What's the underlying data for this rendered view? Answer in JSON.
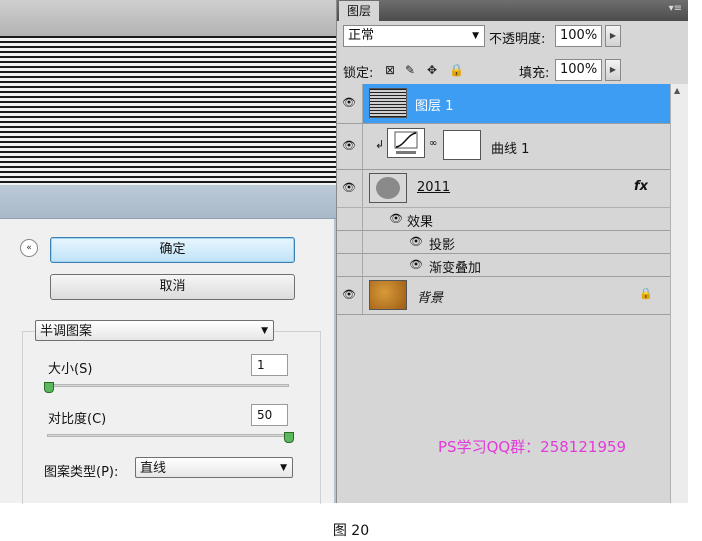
{
  "dialog": {
    "ok_label": "确定",
    "cancel_label": "取消",
    "collapse_glyph": "«",
    "pattern_mode": "半调图案",
    "size_label": "大小(S)",
    "size_value": "1",
    "size_level": 0,
    "contrast_label": "对比度(C)",
    "contrast_value": "50",
    "contrast_level": 1,
    "pattern_type_label": "图案类型(P):",
    "pattern_type_value": "直线"
  },
  "layers_panel": {
    "tab_label": "图层",
    "blend_mode": "正常",
    "opacity_label": "不透明度:",
    "opacity_value": "100%",
    "lock_label": "锁定:",
    "fill_label": "填充:",
    "fill_value": "100%",
    "layers": [
      {
        "name": "图层 1",
        "selected": true
      },
      {
        "name": "曲线 1",
        "type": "adjustment"
      },
      {
        "name": "2011",
        "fx": "fx"
      },
      {
        "name": "效果",
        "type": "effects-group"
      },
      {
        "name": "投影",
        "type": "effect"
      },
      {
        "name": "渐变叠加",
        "type": "effect"
      },
      {
        "name": "背景",
        "locked": true
      }
    ]
  },
  "watermark": "PS学习QQ群：258121959",
  "caption": "图 20",
  "colors": {
    "selection": "#3d9df2",
    "watermark": "#e23bd9"
  }
}
